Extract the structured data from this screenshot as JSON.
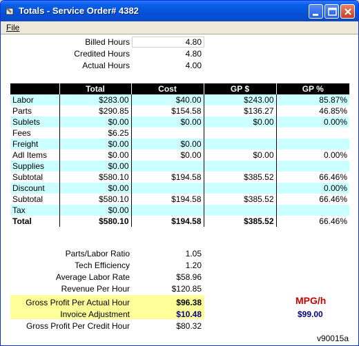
{
  "window": {
    "title": "Totals - Service Order# 4382"
  },
  "menu": {
    "file": "File"
  },
  "hours": [
    {
      "label": "Billed Hours",
      "value": "4.80"
    },
    {
      "label": "Credited Hours",
      "value": "4.80"
    },
    {
      "label": "Actual Hours",
      "value": "4.00"
    }
  ],
  "table": {
    "headers": [
      "",
      "Total",
      "Cost",
      "GP $",
      "GP %"
    ],
    "rows": [
      [
        "Labor",
        "$283.00",
        "$40.00",
        "$243.00",
        "85.87%"
      ],
      [
        "Parts",
        "$290.85",
        "$154.58",
        "$136.27",
        "46.85%"
      ],
      [
        "Sublets",
        "$0.00",
        "$0.00",
        "$0.00",
        "0.00%"
      ],
      [
        "Fees",
        "$6.25",
        "",
        "",
        ""
      ],
      [
        "Freight",
        "$0.00",
        "$0.00",
        "",
        ""
      ],
      [
        "Adl Items",
        "$0.00",
        "$0.00",
        "$0.00",
        "0.00%"
      ],
      [
        "Supplies",
        "$0.00",
        "",
        "",
        ""
      ],
      [
        "Subtotal",
        "$580.10",
        "$194.58",
        "$385.52",
        "66.46%"
      ],
      [
        "Discount",
        "$0.00",
        "",
        "",
        "0.00%"
      ],
      [
        "Subtotal",
        "$580.10",
        "$194.58",
        "$385.52",
        "66.46%"
      ],
      [
        "Tax",
        "$0.00",
        "",
        "",
        ""
      ],
      [
        "Total",
        "$580.10",
        "$194.58",
        "$385.52",
        "66.46%"
      ]
    ]
  },
  "stats": [
    {
      "label": "Parts/Labor Ratio",
      "value": "1.05"
    },
    {
      "label": "Tech Efficiency",
      "value": "1.20"
    },
    {
      "label": "Average Labor Rate",
      "value": "$58.96"
    },
    {
      "label": "Revenue Per Hour",
      "value": "$120.85"
    },
    {
      "label": "Gross Profit Per Actual Hour",
      "value": "$96.38"
    },
    {
      "label": "Invoice Adjustment",
      "value": "$10.48"
    },
    {
      "label": "Gross Profit Per Credit Hour",
      "value": "$80.32"
    }
  ],
  "mpg": {
    "label": "MPG/h",
    "value": "$99.00"
  },
  "version": "v90015a",
  "colors": {
    "highlight": "#ffff99",
    "row_alt": "#ccffff",
    "mpg_label": "#cc0000",
    "mpg_value": "#000080"
  }
}
